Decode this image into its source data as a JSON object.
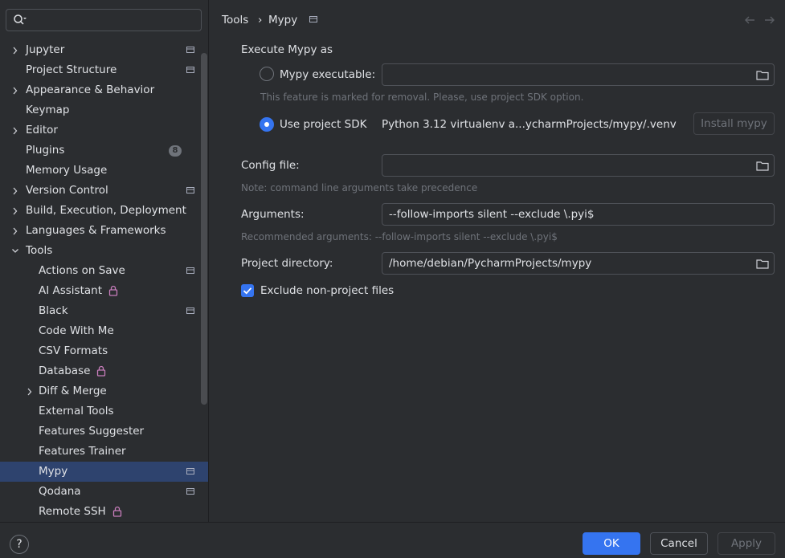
{
  "sidebar": {
    "search": {
      "value": "",
      "placeholder": ""
    },
    "items": [
      {
        "label": "Jupyter",
        "expandable": true,
        "project_scoped": true
      },
      {
        "label": "Project Structure",
        "project_scoped": true
      },
      {
        "label": "Appearance & Behavior",
        "expandable": true
      },
      {
        "label": "Keymap"
      },
      {
        "label": "Editor",
        "expandable": true
      },
      {
        "label": "Plugins",
        "badge": "8"
      },
      {
        "label": "Memory Usage"
      },
      {
        "label": "Version Control",
        "expandable": true,
        "project_scoped": true
      },
      {
        "label": "Build, Execution, Deployment",
        "expandable": true
      },
      {
        "label": "Languages & Frameworks",
        "expandable": true
      },
      {
        "label": "Tools",
        "expanded": true
      },
      {
        "label": "Actions on Save",
        "child": true,
        "project_scoped": true
      },
      {
        "label": "AI Assistant",
        "child": true,
        "locked": true
      },
      {
        "label": "Black",
        "child": true,
        "project_scoped": true
      },
      {
        "label": "Code With Me",
        "child": true
      },
      {
        "label": "CSV Formats",
        "child": true
      },
      {
        "label": "Database",
        "child": true,
        "locked": true
      },
      {
        "label": "Diff & Merge",
        "child": true,
        "expandable": true
      },
      {
        "label": "External Tools",
        "child": true
      },
      {
        "label": "Features Suggester",
        "child": true
      },
      {
        "label": "Features Trainer",
        "child": true
      },
      {
        "label": "Mypy",
        "child": true,
        "selected": true,
        "project_scoped": true
      },
      {
        "label": "Qodana",
        "child": true,
        "project_scoped": true
      },
      {
        "label": "Remote SSH",
        "child": true,
        "locked": true
      }
    ]
  },
  "breadcrumb": {
    "parent": "Tools",
    "separator": "›",
    "current": "Mypy"
  },
  "main": {
    "execute_label": "Execute Mypy as",
    "mypy_executable": {
      "label": "Mypy executable:",
      "value": "",
      "selected": false
    },
    "removal_note": "This feature is marked for removal. Please, use project SDK option.",
    "project_sdk": {
      "label": "Use project SDK",
      "value": "Python 3.12 virtualenv a...ycharmProjects/mypy/.venv",
      "selected": true
    },
    "install_button": "Install mypy",
    "config_file": {
      "label": "Config file:",
      "value": ""
    },
    "config_note": "Note: command line arguments take precedence",
    "arguments": {
      "label": "Arguments:",
      "value": "--follow-imports silent --exclude \\.pyi$"
    },
    "arguments_note": "Recommended arguments: --follow-imports silent --exclude \\.pyi$",
    "project_directory": {
      "label": "Project directory:",
      "value": "/home/debian/PycharmProjects/mypy"
    },
    "exclude_checkbox": {
      "label": "Exclude non-project files",
      "checked": true
    }
  },
  "footer": {
    "help": "?",
    "ok": "OK",
    "cancel": "Cancel",
    "apply": "Apply"
  },
  "colors": {
    "accent": "#3574f0",
    "selection": "#2e436e",
    "background": "#2b2d30",
    "badge": "#6f737a",
    "lock": "#c77dbb"
  },
  "icons": {
    "search": "search-icon",
    "folder": "folder-icon",
    "lock": "lock-icon",
    "chevron": "chevron-right-icon",
    "project": "project-scope-icon"
  }
}
